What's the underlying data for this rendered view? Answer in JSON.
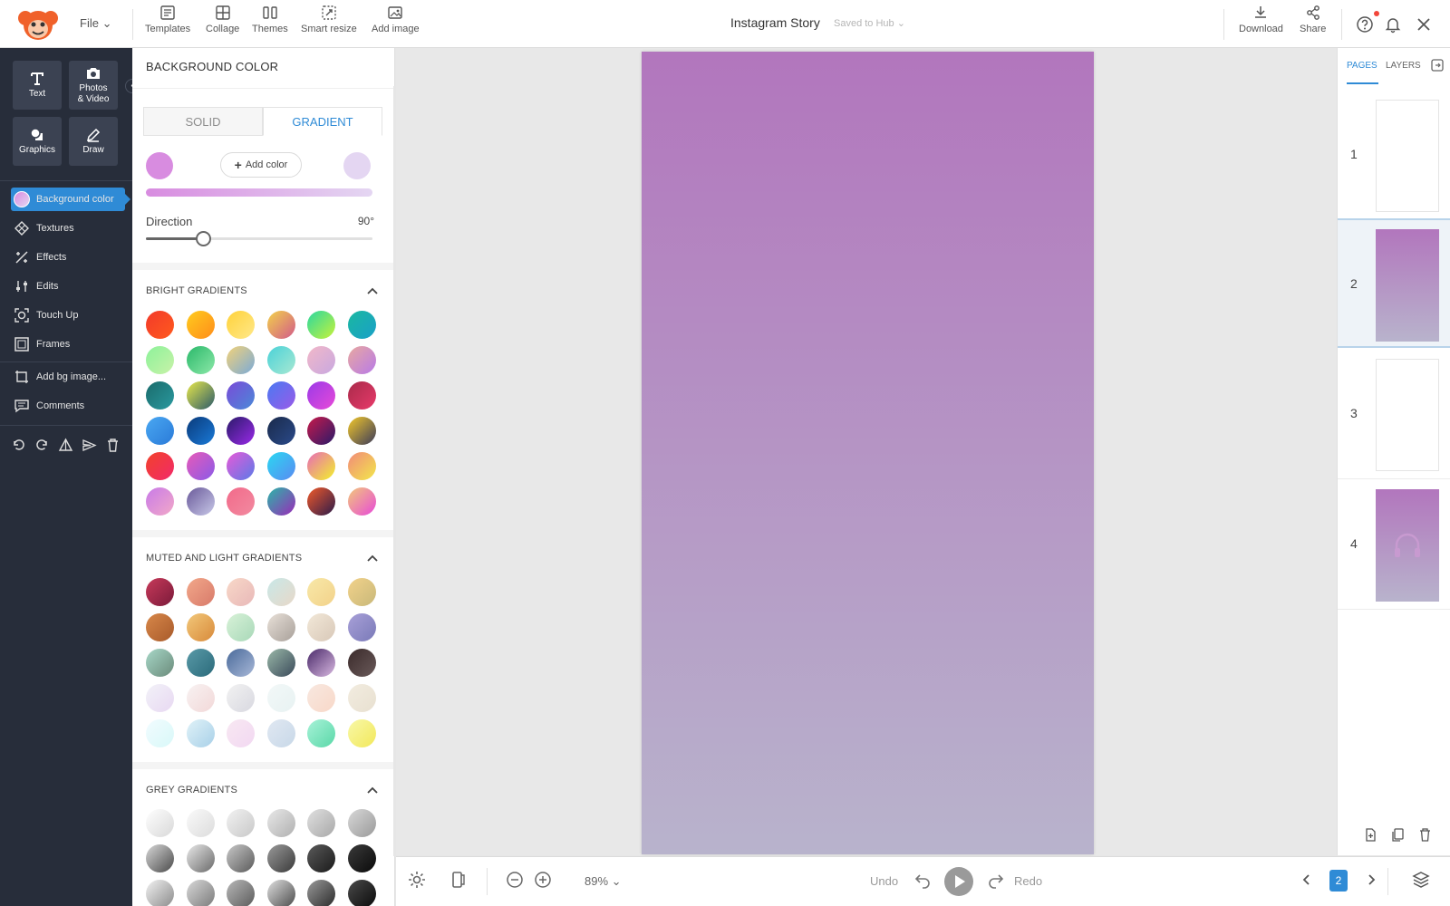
{
  "topbar": {
    "file_label": "File",
    "tools": [
      {
        "label": "Templates",
        "icon": "templates-icon"
      },
      {
        "label": "Collage",
        "icon": "collage-icon"
      },
      {
        "label": "Themes",
        "icon": "themes-icon"
      },
      {
        "label": "Smart resize",
        "icon": "smart-resize-icon"
      },
      {
        "label": "Add image",
        "icon": "add-image-icon"
      }
    ],
    "doc_title": "Instagram Story",
    "saved_status": "Saved to Hub",
    "download_label": "Download",
    "share_label": "Share"
  },
  "leftbar": {
    "buttons": [
      {
        "label": "Text",
        "icon": "text-icon"
      },
      {
        "label": "Photos & Video",
        "icon": "camera-icon"
      },
      {
        "label": "Graphics",
        "icon": "graphics-icon"
      },
      {
        "label": "Draw",
        "icon": "pencil-icon"
      }
    ],
    "nav": [
      {
        "label": "Background color",
        "icon": "background-color-icon",
        "active": true
      },
      {
        "label": "Textures",
        "icon": "textures-icon"
      },
      {
        "label": "Effects",
        "icon": "effects-icon"
      },
      {
        "label": "Edits",
        "icon": "edits-icon"
      },
      {
        "label": "Touch Up",
        "icon": "touch-up-icon"
      },
      {
        "label": "Frames",
        "icon": "frames-icon"
      },
      {
        "label": "Add bg image...",
        "icon": "add-bg-image-icon"
      },
      {
        "label": "Comments",
        "icon": "comments-icon"
      }
    ]
  },
  "panel": {
    "title": "BACKGROUND COLOR",
    "tab_solid": "SOLID",
    "tab_gradient": "GRADIENT",
    "active_tab": "GRADIENT",
    "color_start": "#d88ce0",
    "color_end": "#e4d6f2",
    "add_color_label": "Add color",
    "direction_label": "Direction",
    "direction_value": "90°",
    "direction_fraction": 0.25,
    "sections": [
      {
        "title": "BRIGHT GRADIENTS",
        "swatches": [
          [
            "#f23a2a",
            "#ff5a1e"
          ],
          [
            "#ffcc1e",
            "#ff8c1a"
          ],
          [
            "#ffd23a",
            "#ffe88a"
          ],
          [
            "#f2d24a",
            "#d25a8a"
          ],
          [
            "#2ad8a0",
            "#c8f23a"
          ],
          [
            "#1ab8a0",
            "#1aa0c8"
          ],
          [
            "#8cf29a",
            "#c8f2a8"
          ],
          [
            "#2ab86a",
            "#8ce8a8"
          ],
          [
            "#f2d27a",
            "#7aaad8"
          ],
          [
            "#4ad2d8",
            "#a8e8d2"
          ],
          [
            "#f2b8c8",
            "#c8a8e0"
          ],
          [
            "#e8a8a0",
            "#b87ae8"
          ],
          [
            "#1a6a6a",
            "#2a9aa0"
          ],
          [
            "#e8e84a",
            "#2a5a6a"
          ],
          [
            "#7a4ad8",
            "#4a8ad8"
          ],
          [
            "#4a7af2",
            "#9a5ae8"
          ],
          [
            "#9a3ae8",
            "#e84ad8"
          ],
          [
            "#a82a4a",
            "#e83a6a"
          ],
          [
            "#4aa8f2",
            "#2a7ad8"
          ],
          [
            "#0a3a7a",
            "#1a7ad8"
          ],
          [
            "#2a1a6a",
            "#9a2ae8"
          ],
          [
            "#1a2a4a",
            "#2a4a8a"
          ],
          [
            "#c81a4a",
            "#2a1a6a"
          ],
          [
            "#f2c82a",
            "#3a3a5a"
          ],
          [
            "#f2422a",
            "#f22a6a"
          ],
          [
            "#e85ab8",
            "#8a5ae8"
          ],
          [
            "#e85ad8",
            "#5a7ae8"
          ],
          [
            "#2ad8f2",
            "#5a8af2"
          ],
          [
            "#e86ab8",
            "#f2f22a"
          ],
          [
            "#f28a7a",
            "#f2e84a"
          ],
          [
            "#c87ae8",
            "#f2a8c8"
          ],
          [
            "#6a5a9a",
            "#c8c8e8"
          ],
          [
            "#f26a8a",
            "#f28aa0"
          ],
          [
            "#2ab8a8",
            "#9a2ab8"
          ],
          [
            "#f25a2a",
            "#2a1a4a"
          ],
          [
            "#f2c87a",
            "#e84ad8"
          ]
        ]
      },
      {
        "title": "MUTED AND LIGHT GRADIENTS",
        "swatches": [
          [
            "#c83a5a",
            "#7a1a3a"
          ],
          [
            "#f2a88a",
            "#d87a6a"
          ],
          [
            "#f8d8c8",
            "#e8b8b8"
          ],
          [
            "#c8e8e8",
            "#e8d8c8"
          ],
          [
            "#f8e8a8",
            "#f2d28a"
          ],
          [
            "#f2d28a",
            "#c8b87a"
          ],
          [
            "#d8884a",
            "#a85a2a"
          ],
          [
            "#f2c87a",
            "#d88a3a"
          ],
          [
            "#d8f2d8",
            "#a8d8b8"
          ],
          [
            "#e8e0d8",
            "#a8a09a"
          ],
          [
            "#f2e8d8",
            "#d8c8b8"
          ],
          [
            "#a8a0d8",
            "#7a7ab8"
          ],
          [
            "#a8d8c8",
            "#6a8a7a"
          ],
          [
            "#5a9aa8",
            "#2a6a7a"
          ],
          [
            "#4a6a9a",
            "#a8b8d8"
          ],
          [
            "#9ab8a8",
            "#3a4a5a"
          ],
          [
            "#4a2a6a",
            "#d8b8e0"
          ],
          [
            "#3a2a2a",
            "#6a5a5a"
          ],
          [
            "#f2f2f8",
            "#e8d8f2"
          ],
          [
            "#f8f2f2",
            "#f2d8d8"
          ],
          [
            "#f2f2f2",
            "#d8d8e0"
          ],
          [
            "#f2f8f8",
            "#e8f2f2"
          ],
          [
            "#f8e8e0",
            "#f8d8c8"
          ],
          [
            "#f2ece0",
            "#e8e0d0"
          ],
          [
            "#f2fcff",
            "#d8f8f8"
          ],
          [
            "#e0f2f8",
            "#a8d0e8"
          ],
          [
            "#f8e8f2",
            "#f2d8f2"
          ],
          [
            "#e0e8f2",
            "#c8d8e8"
          ],
          [
            "#a8f2d8",
            "#5ad8a8"
          ],
          [
            "#f8f8a8",
            "#f2e85a"
          ]
        ]
      },
      {
        "title": "GREY GRADIENTS",
        "swatches": [
          [
            "#ffffff",
            "#d8d8d8"
          ],
          [
            "#fafafa",
            "#dcdcdc"
          ],
          [
            "#f2f2f2",
            "#c8c8c8"
          ],
          [
            "#e8e8e8",
            "#b0b0b0"
          ],
          [
            "#e0e0e0",
            "#a8a8a8"
          ],
          [
            "#d8d8d8",
            "#9a9a9a"
          ],
          [
            "#d8d8d8",
            "#4a4a4a"
          ],
          [
            "#e8e8e8",
            "#6a6a6a"
          ],
          [
            "#c8c8c8",
            "#5a5a5a"
          ],
          [
            "#9a9a9a",
            "#3a3a3a"
          ],
          [
            "#5a5a5a",
            "#1a1a1a"
          ],
          [
            "#3a3a3a",
            "#0a0a0a"
          ],
          [
            "#f2f2f2",
            "#8a8a8a"
          ],
          [
            "#d8d8d8",
            "#7a7a7a"
          ],
          [
            "#b8b8b8",
            "#5a5a5a"
          ],
          [
            "#e0e0e0",
            "#4a4a4a"
          ],
          [
            "#9a9a9a",
            "#2a2a2a"
          ],
          [
            "#4a4a4a",
            "#0a0a0a"
          ]
        ]
      }
    ]
  },
  "canvas": {
    "gradient_top": "#b276bd",
    "gradient_bottom": "#b8b3cc"
  },
  "bottombar": {
    "zoom": "89%",
    "undo_label": "Undo",
    "redo_label": "Redo",
    "current_page": "2"
  },
  "rightpanel": {
    "tab_pages": "PAGES",
    "tab_layers": "LAYERS",
    "pages": [
      "1",
      "2",
      "3",
      "4"
    ],
    "selected_page": "2"
  },
  "colors": {
    "accent": "#2f8bd6",
    "sidebar_bg": "#272d3a"
  }
}
